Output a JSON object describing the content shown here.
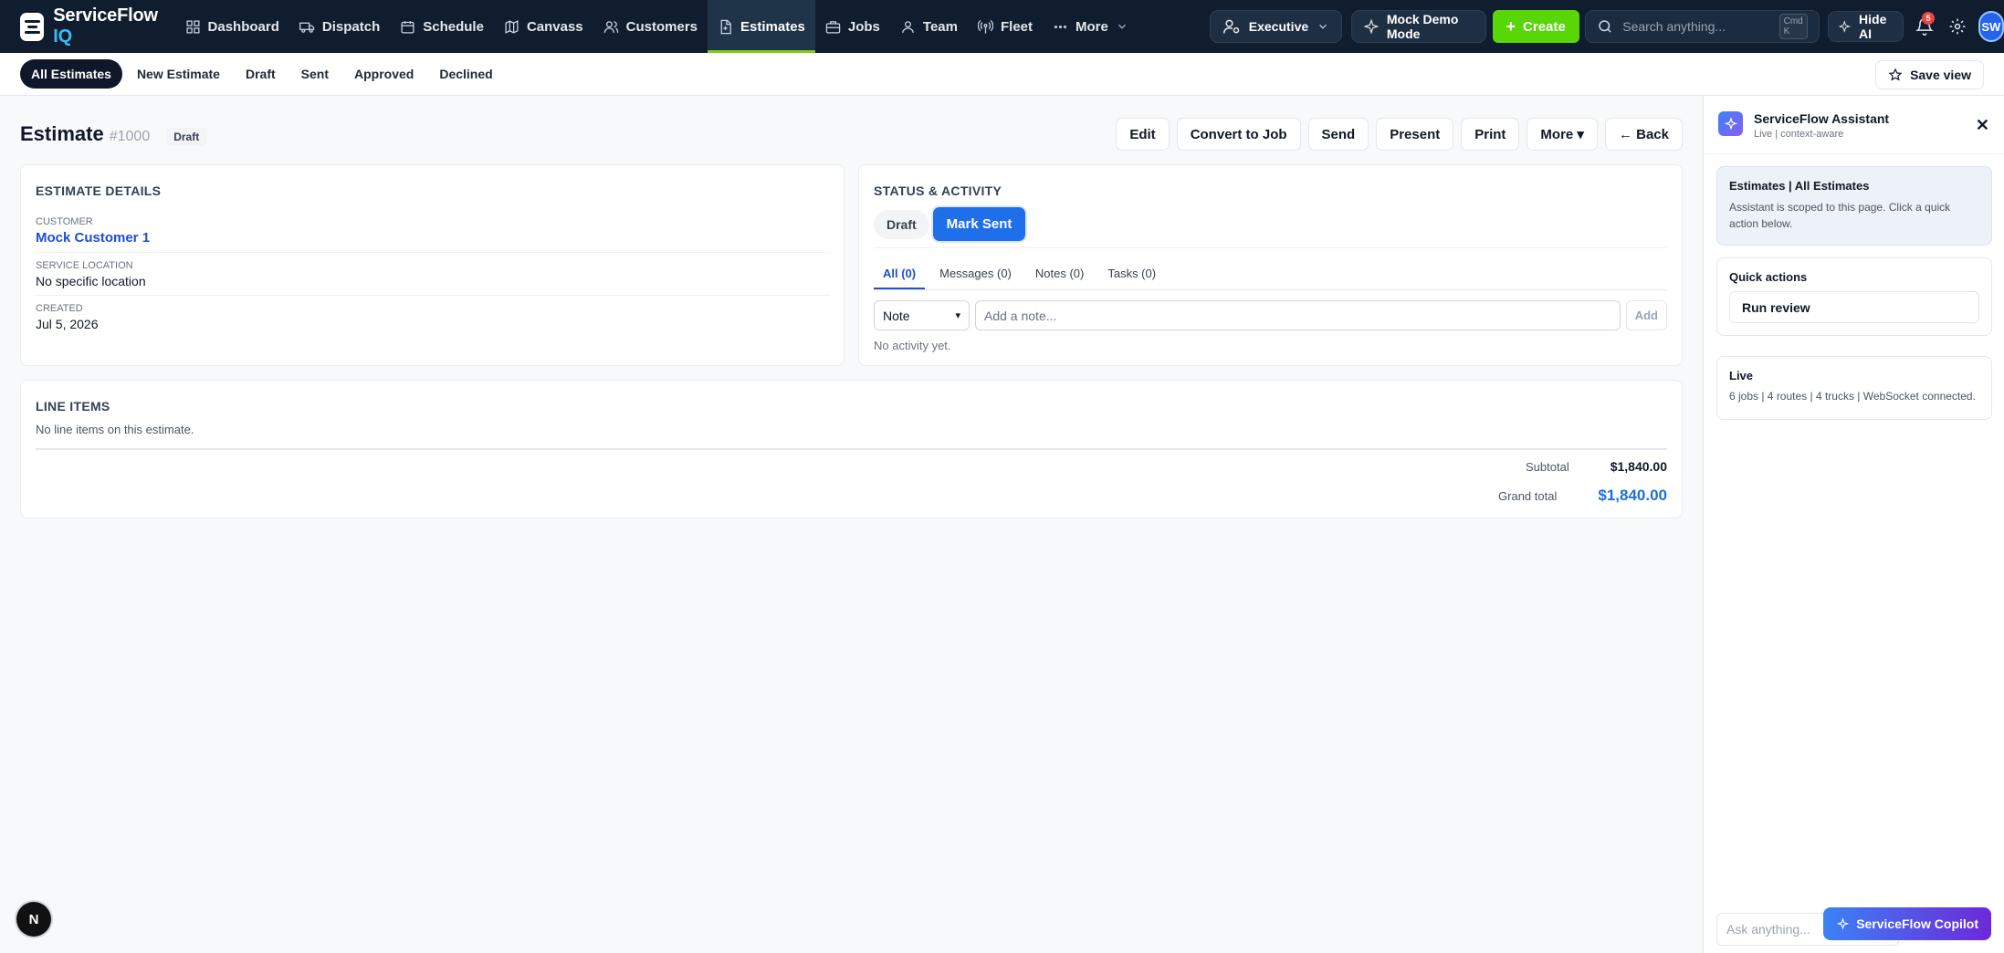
{
  "brand": {
    "name": "ServiceFlow",
    "suffix": "IQ"
  },
  "nav": {
    "items": [
      {
        "label": "Dashboard",
        "icon": "grid-icon"
      },
      {
        "label": "Dispatch",
        "icon": "truck-icon"
      },
      {
        "label": "Schedule",
        "icon": "calendar-icon"
      },
      {
        "label": "Canvass",
        "icon": "map-icon"
      },
      {
        "label": "Customers",
        "icon": "users-icon"
      },
      {
        "label": "Estimates",
        "icon": "file-icon",
        "active": true
      },
      {
        "label": "Jobs",
        "icon": "briefcase-icon"
      },
      {
        "label": "Team",
        "icon": "user-icon"
      },
      {
        "label": "Fleet",
        "icon": "radio-icon"
      },
      {
        "label": "More",
        "icon": "dots-icon"
      }
    ]
  },
  "topbar": {
    "role": "Executive",
    "demo": "Mock Demo Mode",
    "create": "Create",
    "search_placeholder": "Search anything...",
    "kbd_line1": "Cmd",
    "kbd_line2": "K",
    "hide_ai": "Hide AI",
    "notifications": "5",
    "avatar": "SW"
  },
  "subnav": {
    "tabs": [
      "All Estimates",
      "New Estimate",
      "Draft",
      "Sent",
      "Approved",
      "Declined"
    ],
    "save_view": "Save view"
  },
  "estimate": {
    "title": "Estimate",
    "number": "#1000",
    "status": "Draft"
  },
  "actions": [
    "Edit",
    "Convert to Job",
    "Send",
    "Present",
    "Print",
    "More ▾",
    "← Back"
  ],
  "details": {
    "heading": "ESTIMATE DETAILS",
    "customer_label": "CUSTOMER",
    "customer": "Mock Customer 1",
    "location_label": "SERVICE LOCATION",
    "location": "No specific location",
    "created_label": "CREATED",
    "created": "Jul 5, 2026"
  },
  "status_activity": {
    "heading": "STATUS & ACTIVITY",
    "status_draft": "Draft",
    "status_next": "Mark Sent",
    "tabs": [
      "All (0)",
      "Messages (0)",
      "Notes (0)",
      "Tasks (0)"
    ],
    "note_type": "Note",
    "note_placeholder": "Add a note...",
    "add": "Add",
    "empty": "No activity yet."
  },
  "line_items": {
    "heading": "LINE ITEMS",
    "empty": "No line items on this estimate.",
    "subtotal_label": "Subtotal",
    "subtotal": "$1,840.00",
    "grand_total_label": "Grand total",
    "grand_total": "$1,840.00"
  },
  "assistant": {
    "title": "ServiceFlow Assistant",
    "subtitle": "Live | context-aware",
    "scope_title": "Estimates | All Estimates",
    "scope_text": "Assistant is scoped to this page. Click a quick action below.",
    "quick_title": "Quick actions",
    "quick_action": "Run review",
    "live_title": "Live",
    "live_text": "6 jobs | 4 routes | 4 trucks | WebSocket connected.",
    "ask_placeholder": "Ask anything...",
    "copilot": "ServiceFlow Copilot"
  },
  "dev_badge": "N",
  "colors": {
    "nav_bg": "#0f1d2e",
    "accent_green": "#59d607",
    "link_blue": "#1d4ed8",
    "primary_blue": "#1f6feb"
  }
}
